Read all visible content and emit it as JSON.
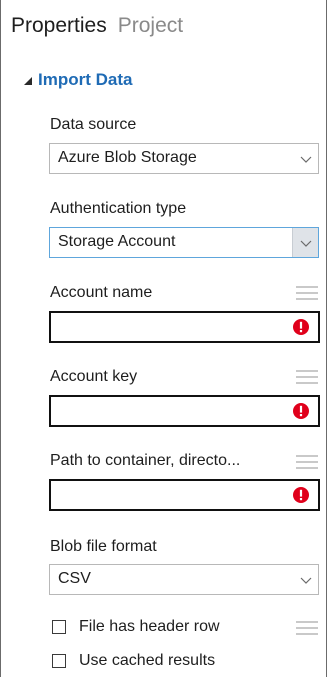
{
  "tabs": {
    "properties": "Properties",
    "project": "Project"
  },
  "section": {
    "title": "Import Data"
  },
  "fields": {
    "data_source": {
      "label": "Data source",
      "value": "Azure Blob Storage"
    },
    "auth_type": {
      "label": "Authentication type",
      "value": "Storage Account"
    },
    "account_name": {
      "label": "Account name",
      "value": ""
    },
    "account_key": {
      "label": "Account key",
      "value": ""
    },
    "path": {
      "label": "Path to container, directo...",
      "value": ""
    },
    "blob_format": {
      "label": "Blob file format",
      "value": "CSV"
    }
  },
  "checkboxes": {
    "header_row": {
      "label": "File has header row",
      "checked": false
    },
    "cached_results": {
      "label": "Use cached results",
      "checked": false
    }
  },
  "colors": {
    "section_title": "#1f6bb5",
    "error": "#e0001b",
    "focus_border": "#5ea6dc",
    "inactive_tab": "#8a8a8a"
  },
  "icons": {
    "section_toggle": "collapse-triangle-icon",
    "dropdown": "chevron-down-icon",
    "error": "error-icon",
    "parameter_menu": "hamburger-icon"
  }
}
